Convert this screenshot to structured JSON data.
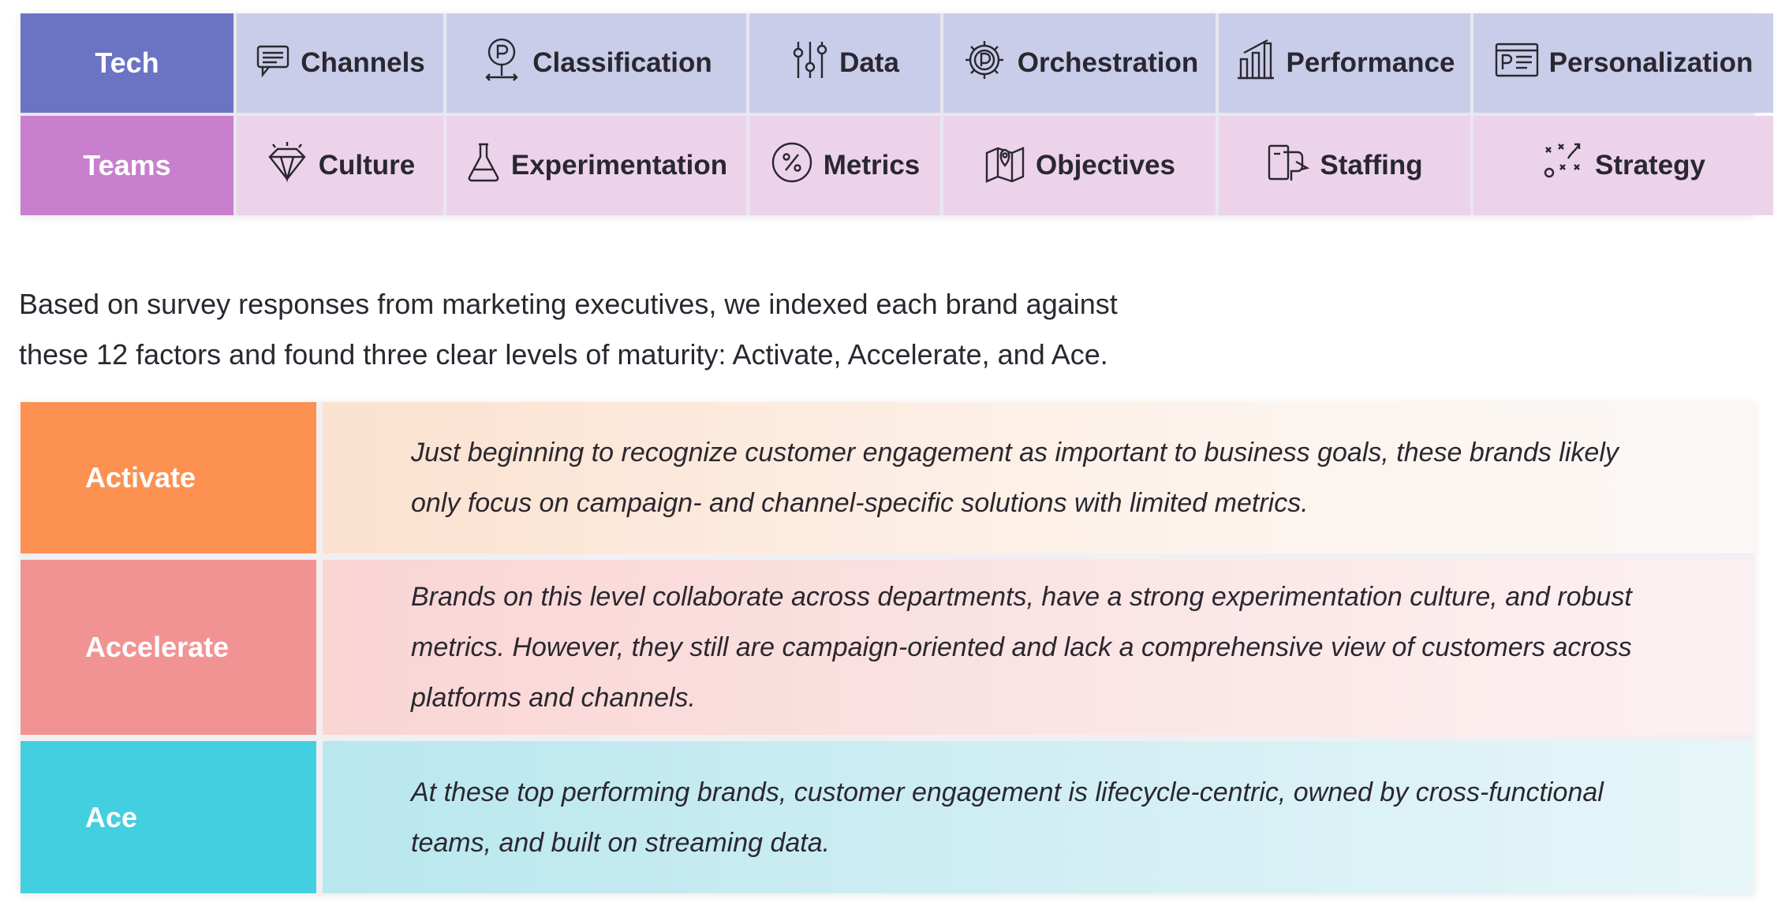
{
  "factors": {
    "tech": {
      "label": "Tech",
      "items": [
        {
          "label": "Channels",
          "icon": "chat-bubble-icon"
        },
        {
          "label": "Classification",
          "icon": "tag-pin-icon"
        },
        {
          "label": "Data",
          "icon": "sliders-icon"
        },
        {
          "label": "Orchestration",
          "icon": "gear-icon"
        },
        {
          "label": "Performance",
          "icon": "bar-chart-icon"
        },
        {
          "label": "Personalization",
          "icon": "browser-window-icon"
        }
      ]
    },
    "teams": {
      "label": "Teams",
      "items": [
        {
          "label": "Culture",
          "icon": "diamond-icon"
        },
        {
          "label": "Experimentation",
          "icon": "flask-icon"
        },
        {
          "label": "Metrics",
          "icon": "percent-icon"
        },
        {
          "label": "Objectives",
          "icon": "map-pin-icon"
        },
        {
          "label": "Staffing",
          "icon": "people-icon"
        },
        {
          "label": "Strategy",
          "icon": "play-diagram-icon"
        }
      ]
    }
  },
  "intro": {
    "line1": "Based on survey responses from marketing executives, we indexed each brand against",
    "line2": "these 12 factors and found three clear levels of maturity: Activate, Accelerate, and Ace."
  },
  "levels": [
    {
      "name": "Activate",
      "description": "Just beginning to recognize customer engagement as important to business goals, these brands likely only focus on campaign- and channel-specific solutions with limited metrics."
    },
    {
      "name": "Accelerate",
      "description": "Brands on this level collaborate across departments, have a strong experimentation culture, and robust metrics. However, they still are campaign-oriented and lack a comprehensive view of customers across platforms and channels."
    },
    {
      "name": "Ace",
      "description": "At these top performing brands, customer engagement is lifecycle-centric, owned by cross-functional teams, and built on streaming data."
    }
  ],
  "colors": {
    "tech_header": "#6b74c2",
    "teams_header": "#c87fcd",
    "activate": "#fc9151",
    "accelerate": "#f29393",
    "ace": "#42cfe0"
  }
}
